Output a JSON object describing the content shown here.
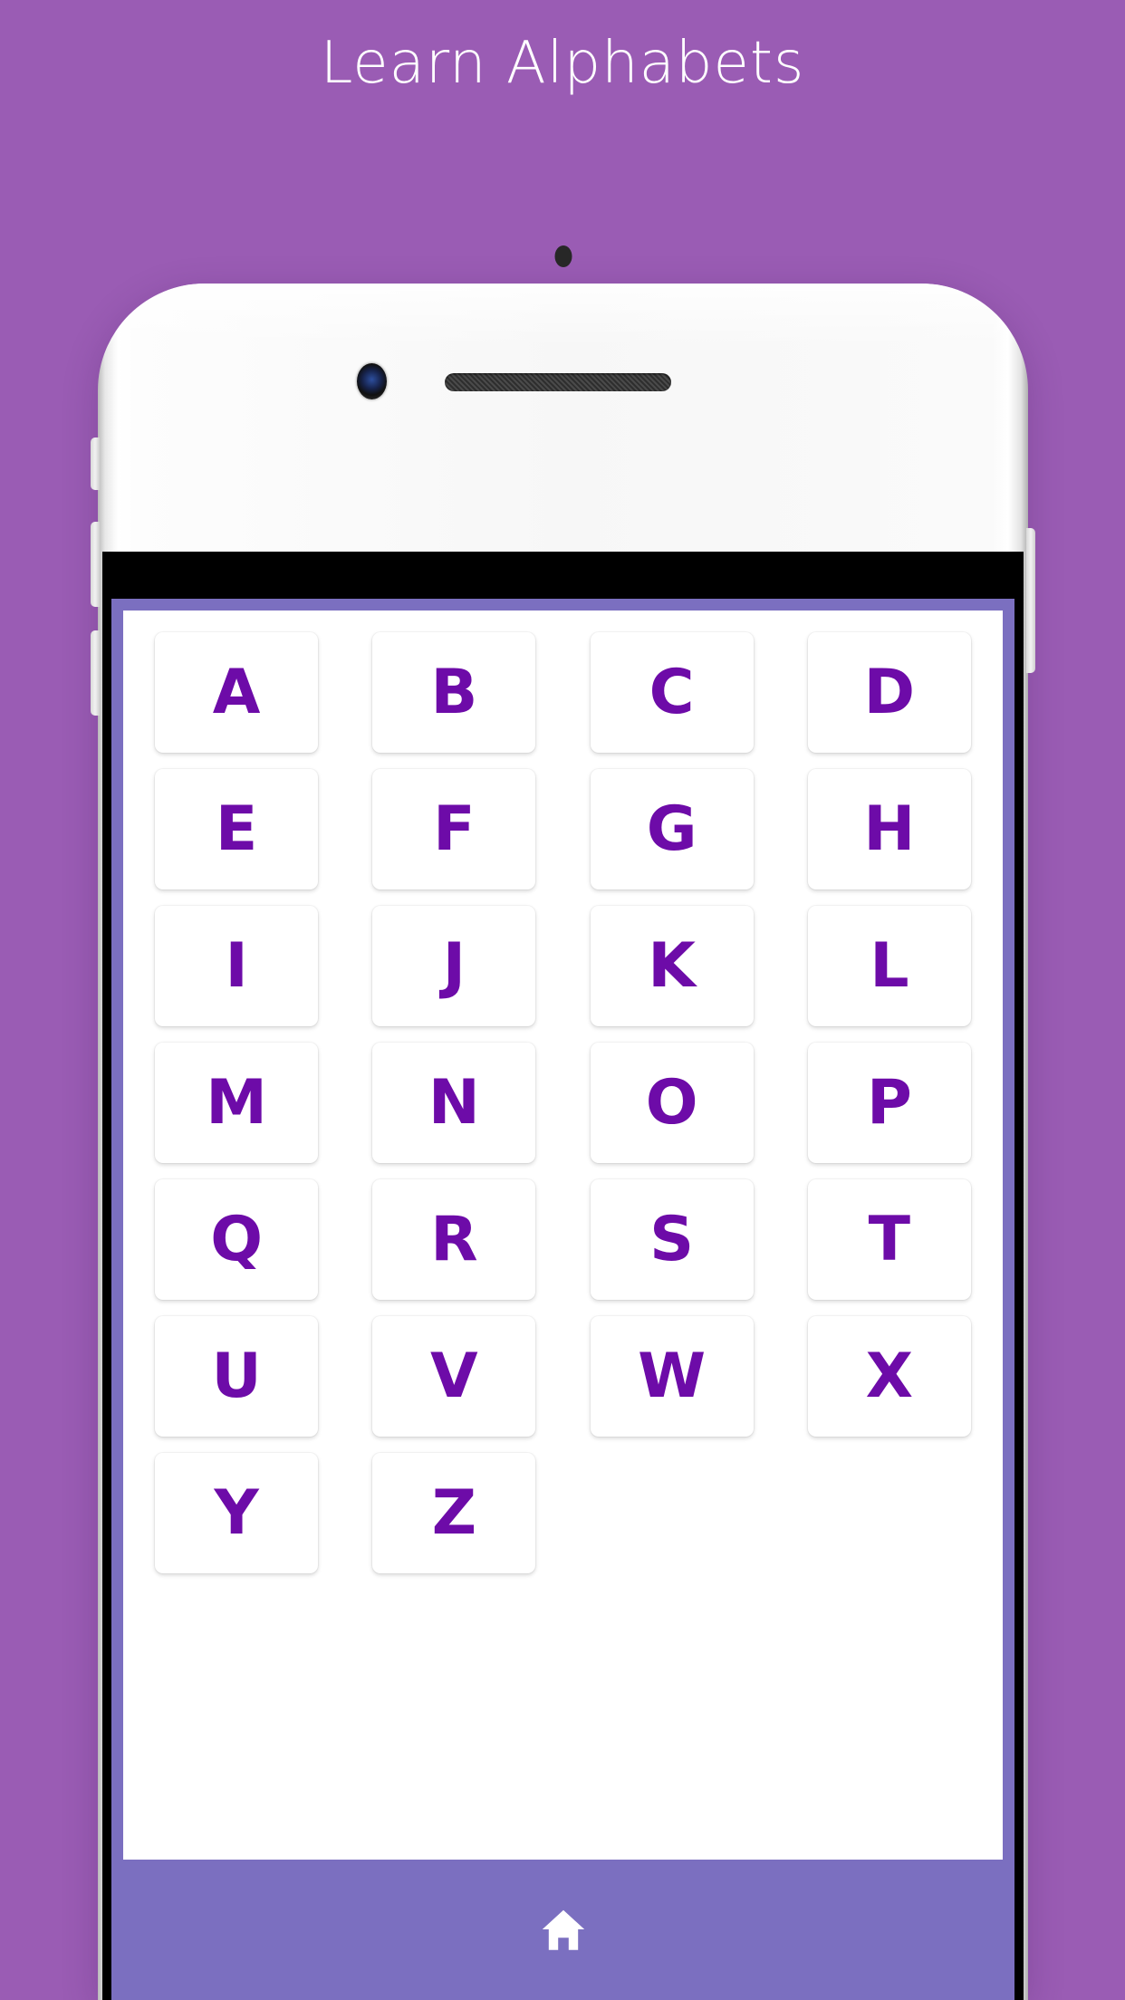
{
  "page": {
    "title": "Learn Alphabets",
    "background_color": "#9a5cb4"
  },
  "theme": {
    "background_purple": "#9a5cb4",
    "app_frame_purple": "#7b6fc0",
    "letter_purple": "#6d0ba8",
    "tile_white": "#ffffff",
    "status_bar_black": "#000000",
    "phone_body_white": "#f7f7f7"
  },
  "device": {
    "name": "white-smartphone-mockup",
    "front_camera": "camera-icon",
    "sensor": "proximity-sensor-dot",
    "speaker": "earpiece-speaker-grille",
    "buttons": [
      {
        "name": "silent-switch"
      },
      {
        "name": "volume-up-button"
      },
      {
        "name": "volume-down-button"
      },
      {
        "name": "power-button"
      }
    ]
  },
  "screen": {
    "status_bar": {
      "visible": true
    },
    "grid": {
      "columns": 4,
      "rows": 7,
      "letters": [
        "A",
        "B",
        "C",
        "D",
        "E",
        "F",
        "G",
        "H",
        "I",
        "J",
        "K",
        "L",
        "M",
        "N",
        "O",
        "P",
        "Q",
        "R",
        "S",
        "T",
        "U",
        "V",
        "W",
        "X",
        "Y",
        "Z"
      ]
    },
    "bottom_nav": {
      "items": [
        {
          "icon": "home-icon",
          "label": ""
        }
      ]
    }
  }
}
